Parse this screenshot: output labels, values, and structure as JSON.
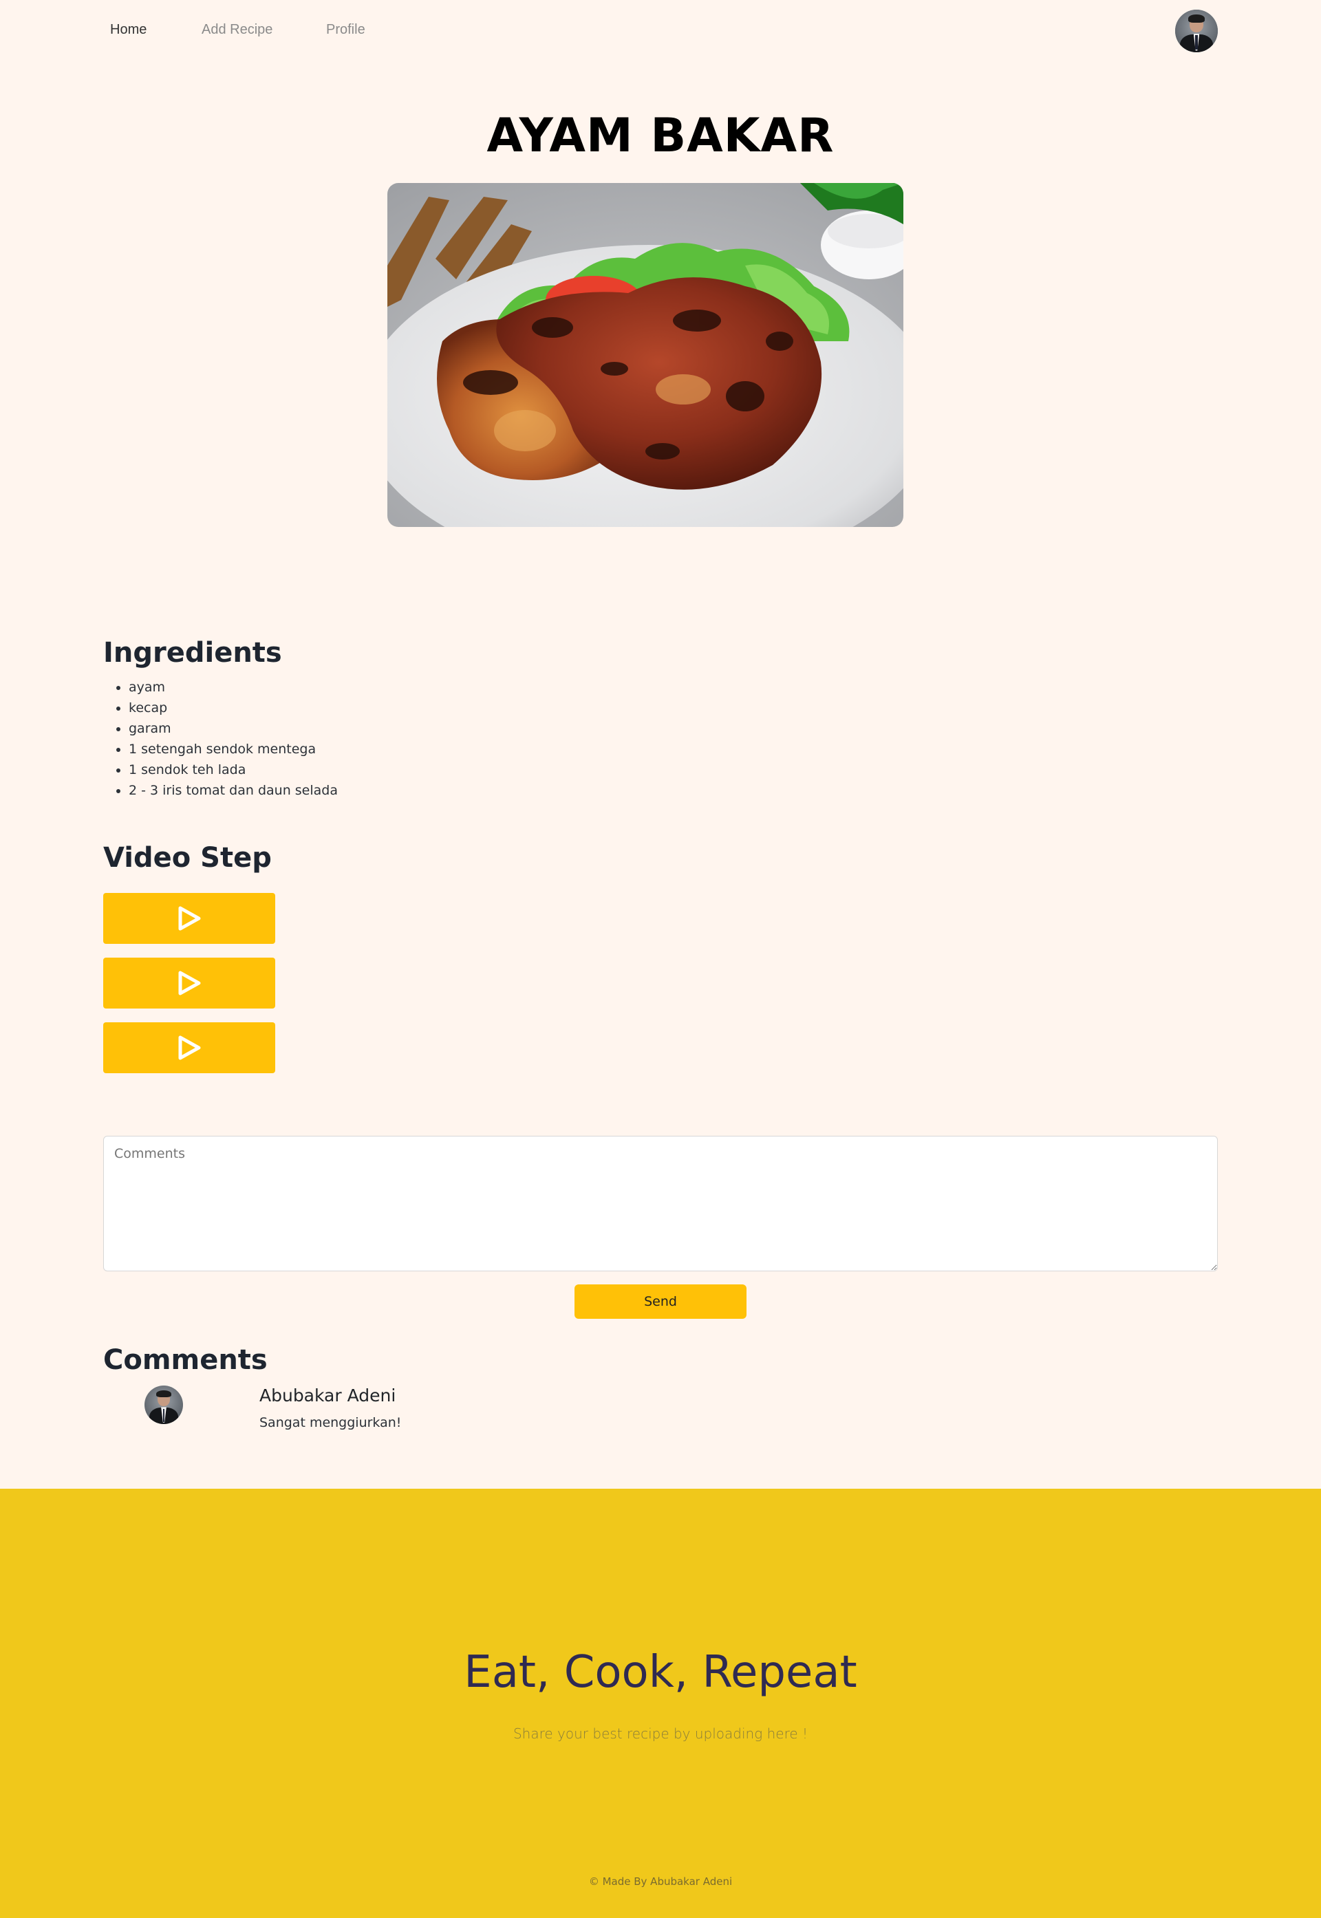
{
  "nav": {
    "items": [
      {
        "label": "Home",
        "active": true
      },
      {
        "label": "Add Recipe",
        "active": false
      },
      {
        "label": "Profile",
        "active": false
      }
    ],
    "avatar_icon": "user-avatar"
  },
  "recipe": {
    "title": "AYAM BAKAR",
    "image_icon": "grilled-chicken-photo"
  },
  "ingredients": {
    "heading": "Ingredients",
    "items": [
      "ayam",
      "kecap",
      "garam",
      "1 setengah sendok mentega",
      "1 sendok teh lada",
      "2 - 3 iris tomat dan daun selada"
    ]
  },
  "video": {
    "heading": "Video Step",
    "buttons": [
      {
        "icon": "play-icon"
      },
      {
        "icon": "play-icon"
      },
      {
        "icon": "play-icon"
      }
    ]
  },
  "comment_form": {
    "placeholder": "Comments",
    "send_label": "Send"
  },
  "comments": {
    "heading": "Comments",
    "items": [
      {
        "name": "Abubakar Adeni",
        "text": "Sangat menggiurkan!"
      }
    ]
  },
  "footer": {
    "heading": "Eat, Cook, Repeat",
    "subtitle": "Share your best recipe by uploading here !",
    "copyright": "© Made By Abubakar Adeni"
  },
  "colors": {
    "background": "#fff5ee",
    "accent": "#ffc107",
    "footer": "#f0c81b",
    "footer_heading": "#2f2a52"
  }
}
